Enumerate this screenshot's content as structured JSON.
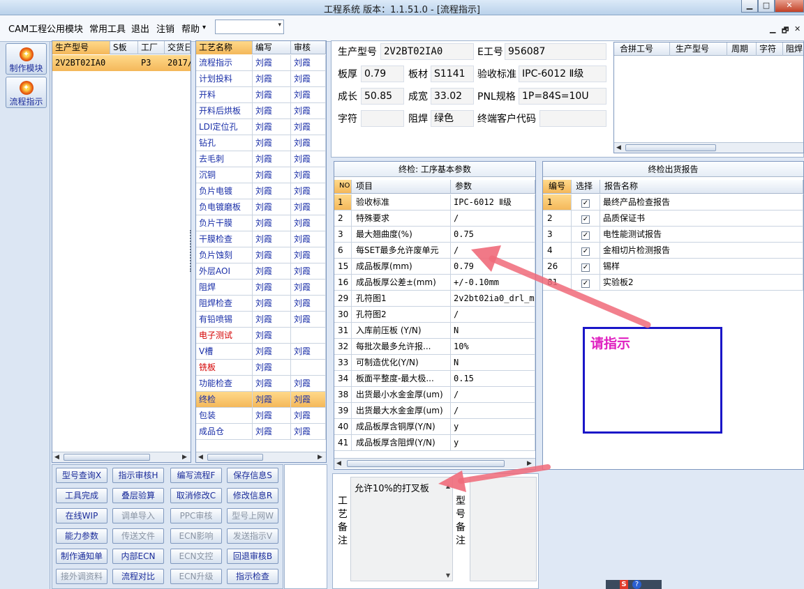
{
  "window": {
    "title": "工程系统   版本：1.1.51.0 - [流程指示]",
    "min": "▁",
    "max": "□",
    "close": "✕"
  },
  "menubar": {
    "items": [
      "CAM工程",
      "公用模块",
      "常用工具",
      "退出",
      "注销",
      "帮助"
    ],
    "help_arrow": "▾",
    "combo_arrow": "▾",
    "mdi": [
      "▁",
      "🗗",
      "✕"
    ]
  },
  "sidebar": {
    "items": [
      {
        "label": "制作模块",
        "icon": "✦"
      },
      {
        "label": "流程指示",
        "icon": "✦"
      }
    ]
  },
  "model_table": {
    "headers": [
      "生产型号",
      "S板",
      "工厂",
      "交货日"
    ],
    "rows": [
      [
        "2V2BT02IA0",
        "",
        "P3",
        "2017/"
      ]
    ]
  },
  "process_table": {
    "headers": [
      "工艺名称",
      "编写",
      "审核"
    ],
    "rows": [
      [
        "流程指示",
        "刘霞",
        "刘霞"
      ],
      [
        "计划投料",
        "刘霞",
        "刘霞"
      ],
      [
        "开料",
        "刘霞",
        "刘霞"
      ],
      [
        "开料后烘板",
        "刘霞",
        "刘霞"
      ],
      [
        "LDI定位孔",
        "刘霞",
        "刘霞"
      ],
      [
        "钻孔",
        "刘霞",
        "刘霞"
      ],
      [
        "去毛刺",
        "刘霞",
        "刘霞"
      ],
      [
        "沉铜",
        "刘霞",
        "刘霞"
      ],
      [
        "负片电镀",
        "刘霞",
        "刘霞"
      ],
      [
        "负电镀磨板",
        "刘霞",
        "刘霞"
      ],
      [
        "负片干膜",
        "刘霞",
        "刘霞"
      ],
      [
        "干膜检查",
        "刘霞",
        "刘霞"
      ],
      [
        "负片蚀刻",
        "刘霞",
        "刘霞"
      ],
      [
        "外层AOI",
        "刘霞",
        "刘霞"
      ],
      [
        "阻焊",
        "刘霞",
        "刘霞"
      ],
      [
        "阻焊检查",
        "刘霞",
        "刘霞"
      ],
      [
        "有铅喷锡",
        "刘霞",
        "刘霞"
      ],
      [
        "电子测试",
        "刘霞",
        ""
      ],
      [
        "V槽",
        "刘霞",
        "刘霞"
      ],
      [
        "铣板",
        "刘霞",
        ""
      ],
      [
        "功能检查",
        "刘霞",
        "刘霞"
      ],
      [
        "终检",
        "刘霞",
        "刘霞"
      ],
      [
        "包装",
        "刘霞",
        "刘霞"
      ],
      [
        "成品仓",
        "刘霞",
        "刘霞"
      ]
    ]
  },
  "buttons": [
    [
      "型号查询X",
      "指示审核H",
      "编写流程F",
      "保存信息S"
    ],
    [
      "工具完成",
      "叠层验算",
      "取消修改C",
      "修改信息R"
    ],
    [
      "在线WIP",
      "调单导入",
      "PPC审核",
      "型号上网W"
    ],
    [
      "能力参数",
      "传送文件",
      "ECN影响",
      "发送指示V"
    ],
    [
      "制作通知单",
      "内部ECN",
      "ECN文控",
      "回退审核B"
    ],
    [
      "接外调资料",
      "流程对比",
      "ECN升级",
      "指示检查"
    ]
  ],
  "info": {
    "l_model": "生产型号",
    "model": "2V2BT02IA0",
    "l_eno": "E工号",
    "eno": "956087",
    "l_thick": "板厚",
    "thick": "0.79",
    "l_mat": "板材",
    "mat": "S1141",
    "l_std": "验收标准",
    "std": "IPC-6012 Ⅱ级",
    "l_len": "成长",
    "len": "50.85",
    "l_wid": "成宽",
    "wid": "33.02",
    "l_pnl": "PNL规格",
    "pnl": "1P=84S=10U",
    "l_char": "字符",
    "char": "",
    "l_mask": "阻焊",
    "mask": "绿色",
    "l_cust": "终端客户代码",
    "cust": ""
  },
  "merge_table": {
    "headers": [
      "合拼工号",
      "生产型号",
      "周期",
      "字符",
      "阻焊"
    ]
  },
  "params": {
    "title": "终检: 工序基本参数",
    "headers": [
      "NO",
      "项目",
      "参数"
    ],
    "rows": [
      [
        "1",
        "验收标准",
        "IPC-6012 Ⅱ级"
      ],
      [
        "2",
        "特殊要求",
        "/"
      ],
      [
        "3",
        "最大翘曲度(%)",
        "0.75"
      ],
      [
        "6",
        "每SET最多允许废单元",
        "/"
      ],
      [
        "15",
        "成品板厚(mm)",
        "0.79"
      ],
      [
        "16",
        "成品板厚公差±(mm)",
        "+/-0.10mm"
      ],
      [
        "29",
        "孔符图1",
        "2v2bt02ia0_drl_ma"
      ],
      [
        "30",
        "孔符图2",
        "/"
      ],
      [
        "31",
        "入库前压板 (Y/N)",
        "N"
      ],
      [
        "32",
        "每批次最多允许报...",
        "10%"
      ],
      [
        "33",
        "可制造优化(Y/N)",
        "N"
      ],
      [
        "34",
        "板面平整度-最大极...",
        "0.15"
      ],
      [
        "38",
        "出货最小水金金厚(um)",
        "/"
      ],
      [
        "39",
        "出货最大水金金厚(um)",
        "/"
      ],
      [
        "40",
        "成品板厚含铜厚(Y/N)",
        "y"
      ],
      [
        "41",
        "成品板厚含阻焊(Y/N)",
        "y"
      ]
    ]
  },
  "report": {
    "title": "终检出货报告",
    "headers": [
      "编号",
      "选择",
      "报告名称"
    ],
    "rows": [
      [
        "1",
        "✓",
        "最终产品检查报告"
      ],
      [
        "2",
        "✓",
        "品质保证书"
      ],
      [
        "3",
        "✓",
        "电性能测试报告"
      ],
      [
        "4",
        "✓",
        "金相切片检测报告"
      ],
      [
        "26",
        "✓",
        "锡样"
      ],
      [
        "81",
        "✓",
        "实验板2"
      ]
    ]
  },
  "notes": {
    "craft_label": [
      "工",
      "艺",
      "备",
      "注"
    ],
    "craft_text": "允许10%的打叉板",
    "model_label": [
      "型",
      "号",
      "备",
      "注"
    ]
  },
  "annotation": {
    "text": "请指示",
    "color": "#e020c0",
    "border": "#1a16c8",
    "arrow": "#f06a7a"
  },
  "colors": {
    "selected": "#f4b85a",
    "link": "#1a2fa8",
    "warn": "#d40000"
  },
  "tray": [
    "S",
    "?"
  ]
}
